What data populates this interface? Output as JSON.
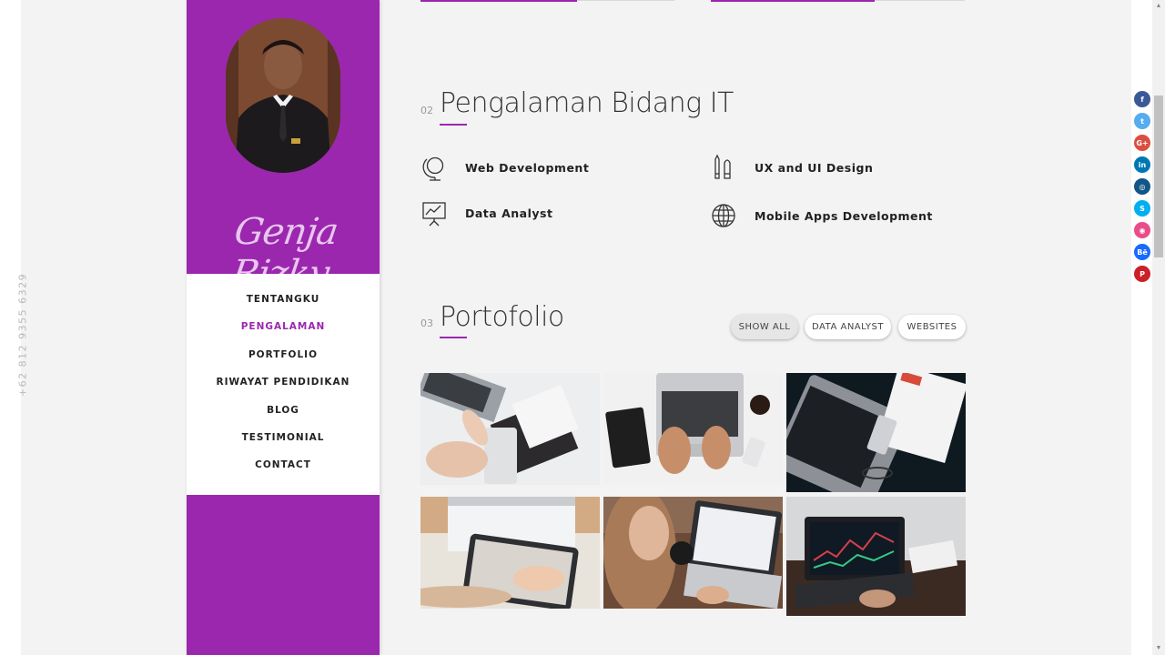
{
  "phone": "+62 812 9355 6329",
  "profile": {
    "signature": "Genja Rizky"
  },
  "nav": {
    "items": [
      {
        "label": "TENTANGKU",
        "active": false
      },
      {
        "label": "PENGALAMAN",
        "active": true
      },
      {
        "label": "PORTFOLIO",
        "active": false
      },
      {
        "label": "RIWAYAT PENDIDIKAN",
        "active": false
      },
      {
        "label": "BLOG",
        "active": false
      },
      {
        "label": "TESTIMONIAL",
        "active": false
      },
      {
        "label": "CONTACT",
        "active": false
      }
    ]
  },
  "experience": {
    "number": "02",
    "title": "Pengalaman Bidang IT",
    "skills": [
      {
        "label": "Web Development",
        "icon": "globe-stand-icon"
      },
      {
        "label": "UX and UI Design",
        "icon": "pens-icon"
      },
      {
        "label": "Data Analyst",
        "icon": "presentation-chart-icon"
      },
      {
        "label": "Mobile Apps Development",
        "icon": "world-grid-icon"
      }
    ]
  },
  "portfolio": {
    "number": "03",
    "title": "Portofolio",
    "filters": [
      {
        "label": "SHOW ALL",
        "active": true
      },
      {
        "label": "DATA ANALYST",
        "active": false
      },
      {
        "label": "WEBSITES",
        "active": false
      }
    ]
  },
  "social": [
    {
      "icon": "facebook-icon",
      "glyph": "f",
      "color": "#3b5998"
    },
    {
      "icon": "twitter-icon",
      "glyph": "t",
      "color": "#55acee"
    },
    {
      "icon": "google-plus-icon",
      "glyph": "G+",
      "color": "#dc4e41"
    },
    {
      "icon": "linkedin-icon",
      "glyph": "in",
      "color": "#0077b5"
    },
    {
      "icon": "instagram-icon",
      "glyph": "◎",
      "color": "#125688"
    },
    {
      "icon": "skype-icon",
      "glyph": "S",
      "color": "#00aff0"
    },
    {
      "icon": "dribbble-icon",
      "glyph": "◉",
      "color": "#ea4c89"
    },
    {
      "icon": "behance-icon",
      "glyph": "Bē",
      "color": "#1769ff"
    },
    {
      "icon": "pinterest-icon",
      "glyph": "P",
      "color": "#cb2027"
    }
  ],
  "colors": {
    "accent": "#9b27af",
    "background": "#f3f3f3"
  }
}
